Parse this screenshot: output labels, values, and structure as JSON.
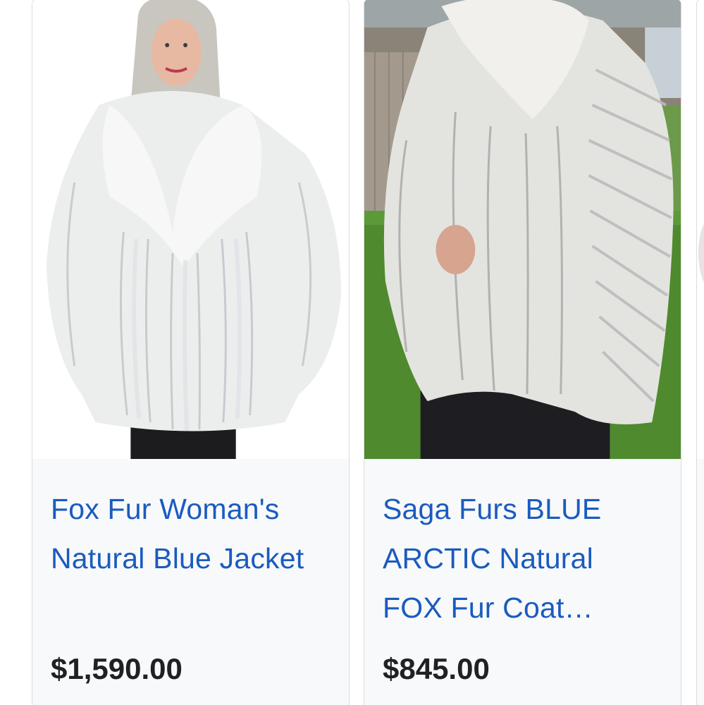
{
  "products": [
    {
      "title": "Fox Fur Woman's Natural Blue Jacket",
      "price": "$1,590.00",
      "image": "fox-fur-jacket-photo"
    },
    {
      "title": "Saga Furs BLUE ARCTIC Natural FOX Fur Coat…",
      "price": "$845.00",
      "image": "saga-furs-coat-photo"
    },
    {
      "image": "next-product-photo-partial"
    }
  ]
}
